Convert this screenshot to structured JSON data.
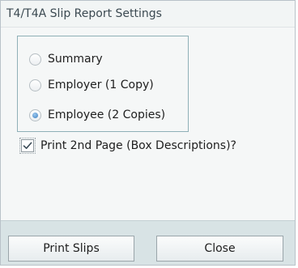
{
  "dialog": {
    "title": "T4/T4A Slip Report Settings"
  },
  "report_options": {
    "items": [
      {
        "label": "Summary",
        "selected": false
      },
      {
        "label": "Employer (1 Copy)",
        "selected": false
      },
      {
        "label": "Employee (2 Copies)",
        "selected": true
      }
    ]
  },
  "print_second_page": {
    "label": "Print 2nd Page (Box Descriptions)?",
    "checked": true
  },
  "buttons": {
    "print_label": "Print Slips",
    "close_label": "Close"
  }
}
